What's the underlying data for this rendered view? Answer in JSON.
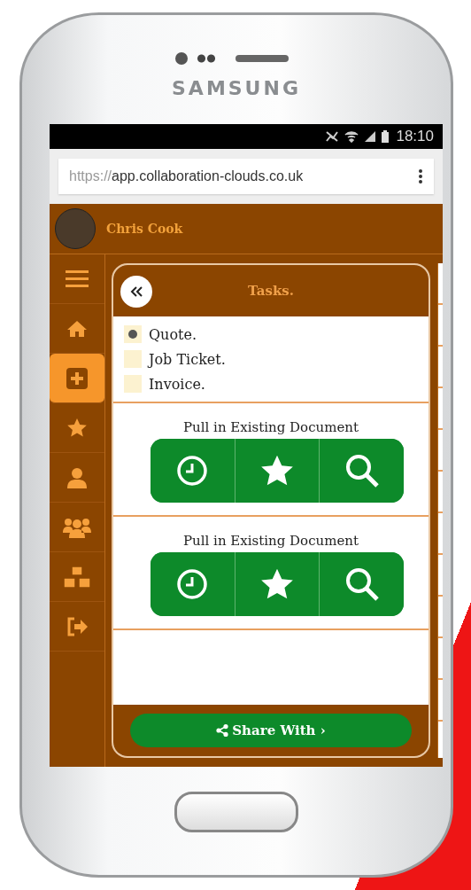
{
  "device": {
    "brand": "SAMSUNG"
  },
  "status_bar": {
    "time": "18:10"
  },
  "browser": {
    "url_prefix": "https://",
    "url_host": "app.collaboration-clouds.co.uk"
  },
  "header": {
    "user_name": "Chris Cook"
  },
  "sidebar": {
    "items": [
      {
        "selected": false
      },
      {
        "selected": false
      },
      {
        "selected": true
      },
      {
        "selected": false
      },
      {
        "selected": false
      },
      {
        "selected": false
      },
      {
        "selected": false
      },
      {
        "selected": false
      }
    ]
  },
  "panel": {
    "title": "Tasks.",
    "options": [
      {
        "label": "Quote.",
        "selected": true
      },
      {
        "label": "Job Ticket.",
        "selected": false
      },
      {
        "label": "Invoice.",
        "selected": false
      }
    ],
    "sections": [
      {
        "title": "Pull in Existing Document"
      },
      {
        "title": "Pull in Existing Document"
      }
    ],
    "share_button": "Share With ›"
  }
}
